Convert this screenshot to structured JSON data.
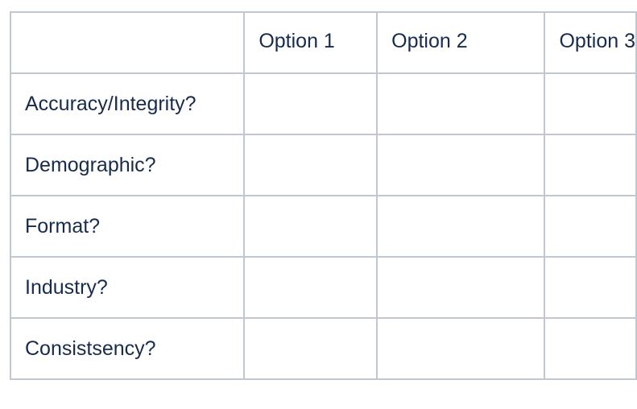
{
  "table": {
    "headers": [
      "",
      "Option 1",
      "Option 2",
      "Option 3"
    ],
    "rows": [
      {
        "label": "Accuracy/Integrity?",
        "cells": [
          "",
          "",
          ""
        ]
      },
      {
        "label": "Demographic?",
        "cells": [
          "",
          "",
          ""
        ]
      },
      {
        "label": "Format?",
        "cells": [
          "",
          "",
          ""
        ]
      },
      {
        "label": "Industry?",
        "cells": [
          "",
          "",
          ""
        ]
      },
      {
        "label": "Consistsency?",
        "cells": [
          "",
          "",
          ""
        ]
      }
    ]
  },
  "colors": {
    "text": "#172B4D",
    "border": "#C1C7D0"
  }
}
